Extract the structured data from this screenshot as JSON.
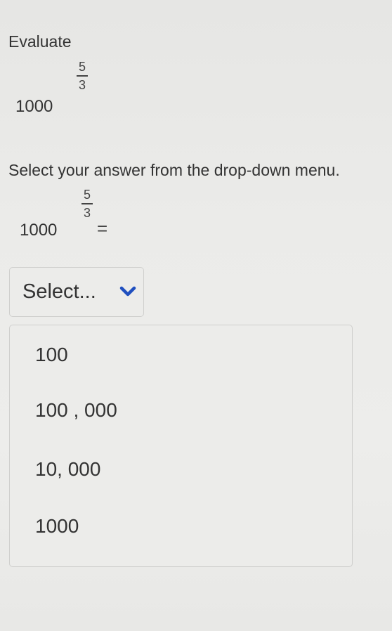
{
  "question": {
    "heading": "Evaluate",
    "expression": {
      "base": "1000",
      "exponent_numerator": "5",
      "exponent_denominator": "3"
    },
    "prompt": "Select your answer from the drop-down menu.",
    "answer_expression": {
      "base": "1000",
      "exponent_numerator": "5",
      "exponent_denominator": "3",
      "equals": "="
    }
  },
  "dropdown": {
    "selected_label": "Select...",
    "chevron_icon": "chevron-down-icon",
    "options": [
      {
        "label": "100"
      },
      {
        "label": "100 , 000"
      },
      {
        "label": "10, 000"
      },
      {
        "label": "1000"
      }
    ]
  }
}
